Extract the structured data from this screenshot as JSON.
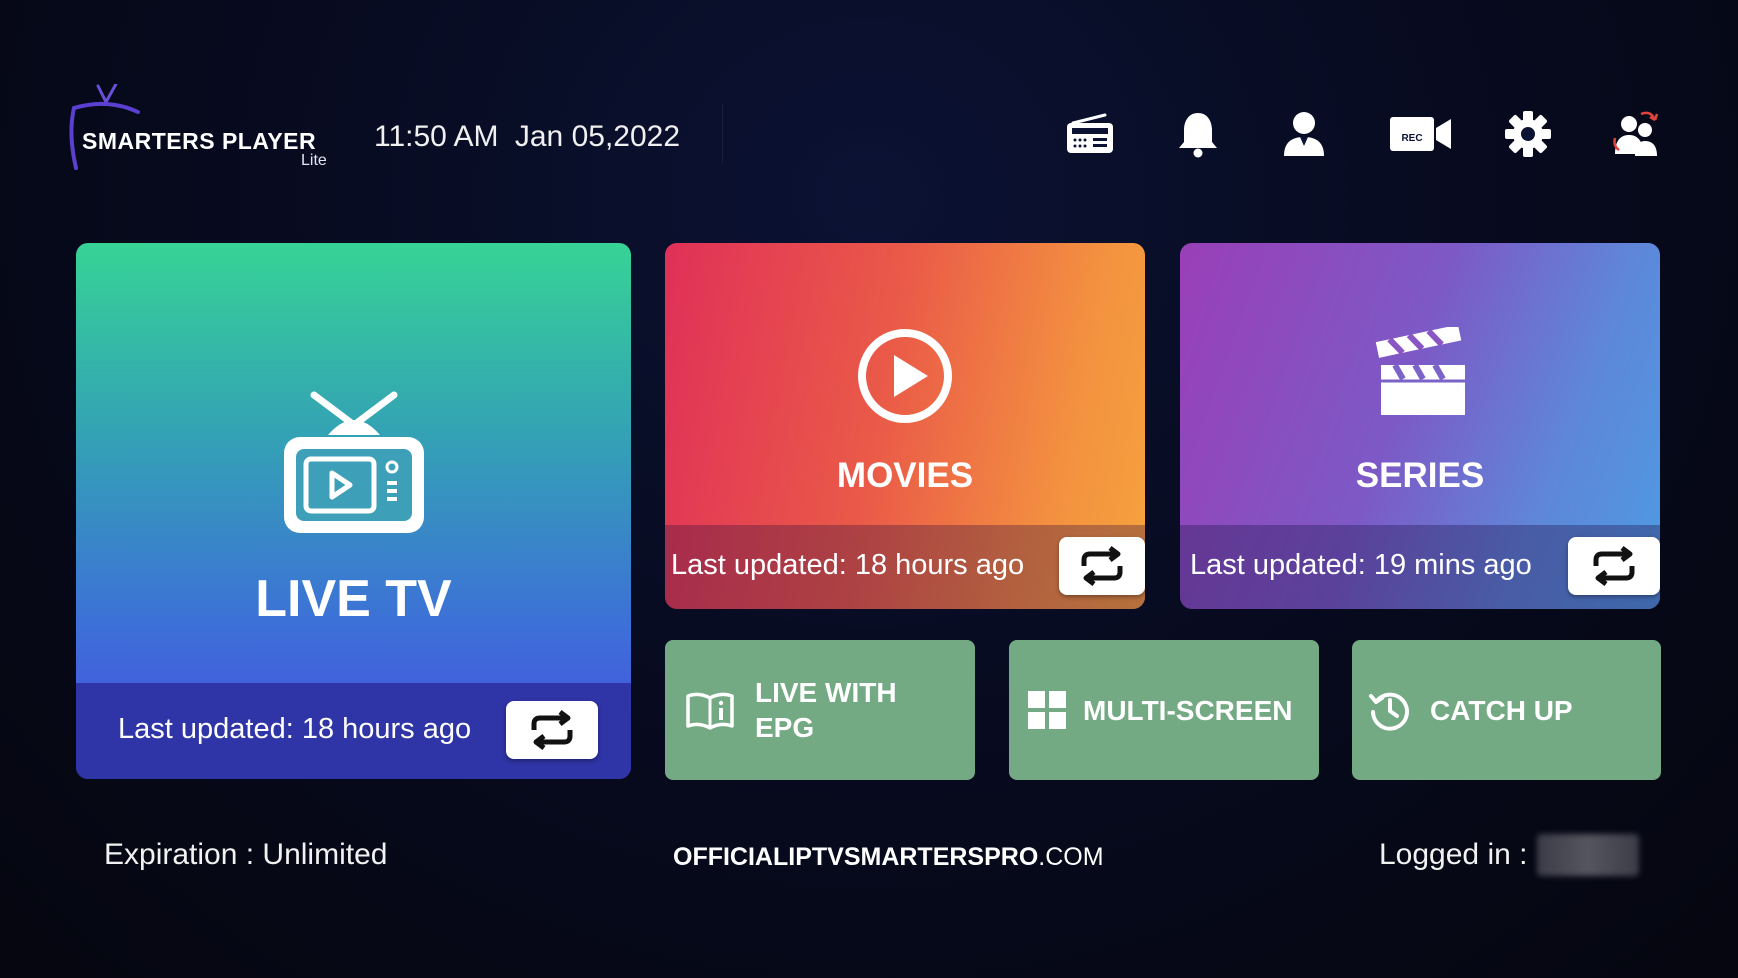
{
  "header": {
    "brand": "SMARTERS PLAYER",
    "brand_sub": "Lite",
    "time": "11:50 AM",
    "date": "Jan 05,2022",
    "icons": [
      "radio-icon",
      "bell-icon",
      "user-icon",
      "record-camera-icon",
      "gear-icon",
      "switch-user-icon"
    ],
    "rec_label": "REC"
  },
  "tiles": {
    "live": {
      "title": "LIVE TV",
      "updated": "Last updated: 18 hours ago"
    },
    "movies": {
      "title": "MOVIES",
      "updated": "Last updated: 18 hours ago"
    },
    "series": {
      "title": "SERIES",
      "updated": "Last updated: 19 mins ago"
    }
  },
  "buttons": {
    "epg_line1": "LIVE WITH",
    "epg_line2": "EPG",
    "multiscreen": "MULTI-SCREEN",
    "catchup": "CATCH UP"
  },
  "footer": {
    "expiration": "Expiration : Unlimited",
    "site_bold": "OFFICIALIPTVSMARTERSPRO",
    "site_suffix": ".COM",
    "logged_in": "Logged in :"
  },
  "colors": {
    "live_top": "#37d396",
    "live_bottom": "#4a4ae0",
    "movies_left": "#e03058",
    "movies_right": "#f6a33d",
    "series_left": "#9a3fb7",
    "series_right": "#4d9be3",
    "action_green": "#73a983",
    "background": "#070a1d"
  }
}
